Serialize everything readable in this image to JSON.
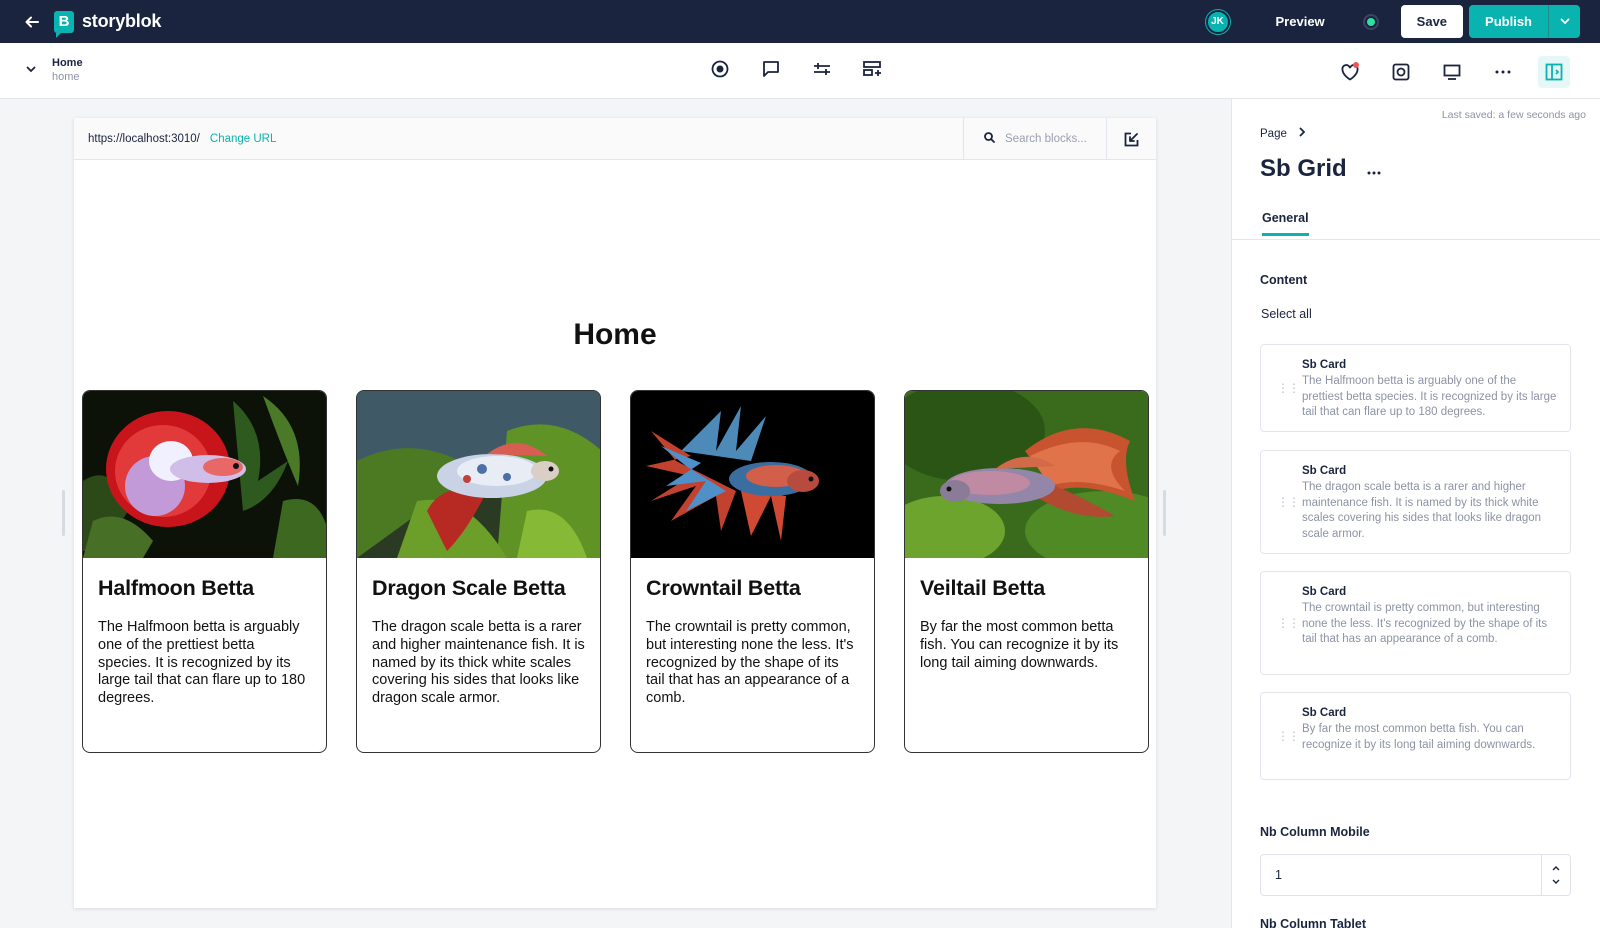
{
  "topbar": {
    "logo_text": "storyblok",
    "logo_mark": "B",
    "avatar_initials": "JK",
    "preview_label": "Preview",
    "save_label": "Save",
    "publish_label": "Publish",
    "accent_color": "#09b3af",
    "bg_color": "#1b243f"
  },
  "toolbar": {
    "story_name": "Home",
    "story_slug": "home",
    "center_icons": [
      "target-icon",
      "comment-icon",
      "settings-sliders-icon",
      "add-block-icon"
    ],
    "right_icons": [
      "favorite-icon",
      "screenshot-icon",
      "desktop-icon",
      "more-icon",
      "panel-toggle-icon"
    ]
  },
  "preview": {
    "url": "https://localhost:3010/",
    "change_url_label": "Change URL",
    "search_placeholder": "Search blocks...",
    "heading": "Home",
    "cards": [
      {
        "title": "Halfmoon Betta",
        "text": "The Halfmoon betta is arguably one of the prettiest betta species. It is recognized by its large tail that can flare up to 180 degrees."
      },
      {
        "title": "Dragon Scale Betta",
        "text": "The dragon scale betta is a rarer and higher maintenance fish. It is named by its thick white scales covering his sides that looks like dragon scale armor."
      },
      {
        "title": "Crowntail Betta",
        "text": "The crowntail is pretty common, but interesting none the less. It's recognized by the shape of its tail that has an appearance of a comb."
      },
      {
        "title": "Veiltail Betta",
        "text": "By far the most common betta fish. You can recognize it by its long tail aiming downwards."
      }
    ]
  },
  "panel": {
    "last_saved": "Last saved: a few seconds ago",
    "breadcrumb": "Page",
    "title": "Sb Grid",
    "tab_general": "General",
    "content_label": "Content",
    "select_all": "Select all",
    "blocks": [
      {
        "title": "Sb Card",
        "desc": "The Halfmoon betta is arguably one of the prettiest betta species. It is recognized by its large tail that can flare up to 180 degrees."
      },
      {
        "title": "Sb Card",
        "desc": "The dragon scale betta is a rarer and higher maintenance fish. It is named by its thick white scales covering his sides that looks like dragon scale armor."
      },
      {
        "title": "Sb Card",
        "desc": "The crowntail is pretty common, but interesting none the less. It's recognized by the shape of its tail that has an appearance of a comb."
      },
      {
        "title": "Sb Card",
        "desc": "By far the most common betta fish. You can recognize it by its long tail aiming downwards."
      }
    ],
    "nb_column_mobile_label": "Nb Column Mobile",
    "nb_column_mobile_value": "1",
    "nb_column_tablet_label": "Nb Column Tablet"
  }
}
